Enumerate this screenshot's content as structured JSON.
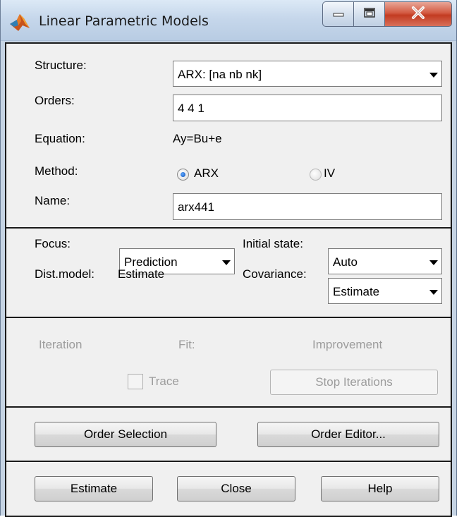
{
  "window": {
    "title": "Linear Parametric Models",
    "accent": "#c6d4e4",
    "close_color": "#c8432a"
  },
  "icons": {
    "app": "matlab-membrane-icon",
    "minimize": "minimize-icon",
    "maximize": "maximize-icon",
    "close": "close-icon"
  },
  "structure": {
    "label": "Structure:",
    "value": "ARX: [na nb nk]"
  },
  "orders": {
    "label": "Orders:",
    "value": "4 4 1"
  },
  "equation": {
    "label": "Equation:",
    "value": "Ay=Bu+e"
  },
  "method": {
    "label": "Method:",
    "options": [
      "ARX",
      "IV"
    ],
    "selected": "ARX"
  },
  "name": {
    "label": "Name:",
    "value": "arx441"
  },
  "focus": {
    "label": "Focus:",
    "value": "Prediction"
  },
  "initial_state": {
    "label": "Initial state:",
    "value": "Auto"
  },
  "dist_model": {
    "label": "Dist.model:",
    "value": "Estimate"
  },
  "covariance": {
    "label": "Covariance:",
    "value": "Estimate"
  },
  "iteration": {
    "iteration_label": "Iteration",
    "fit_label": "Fit:",
    "improvement_label": "Improvement",
    "trace_label": "Trace",
    "trace_checked": false,
    "stop_label": "Stop Iterations"
  },
  "order_buttons": {
    "selection": "Order Selection",
    "editor": "Order Editor..."
  },
  "actions": {
    "estimate": "Estimate",
    "close": "Close",
    "help": "Help"
  }
}
